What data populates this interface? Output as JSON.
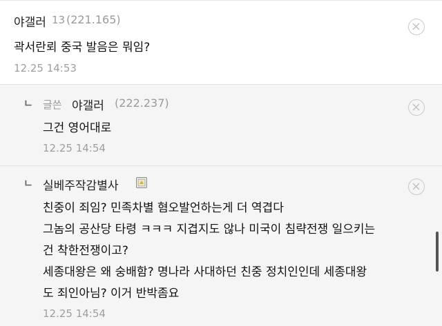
{
  "comments": [
    {
      "nickname": "야갤러",
      "level": "13",
      "ip": "(221.165)",
      "text": "곽서란뢰 중국 발음은 뭐임?",
      "time": "12.25 14:53",
      "delete_icon": "close-circle-icon"
    },
    {
      "reply_marker": "ㄴ",
      "writer_tag": "글쓴",
      "nickname": "야갤러",
      "ip": "(222.237)",
      "text": "그건 영어대로",
      "time": "12.25 14:54",
      "delete_icon": "close-circle-icon"
    },
    {
      "reply_marker": "ㄴ",
      "nickname": "실베주작감별사",
      "badge_icon": "manager-badge-icon",
      "lines": [
        "친중이 죄임? 민족차별 혐오발언하는게 더 역겹다",
        "그놈의 공산당 타령 ㅋㅋㅋ 지겹지도 않나 미국이 침략전쟁 일으키는",
        "건 착한전쟁이고?",
        "세종대왕은 왜 숭배함? 명나라 사대하던 친중 정치인인데 세종대왕",
        "도 죄인아님? 이거 반박좀요"
      ],
      "time": "12.25 14:54",
      "delete_icon": "close-circle-icon"
    }
  ]
}
